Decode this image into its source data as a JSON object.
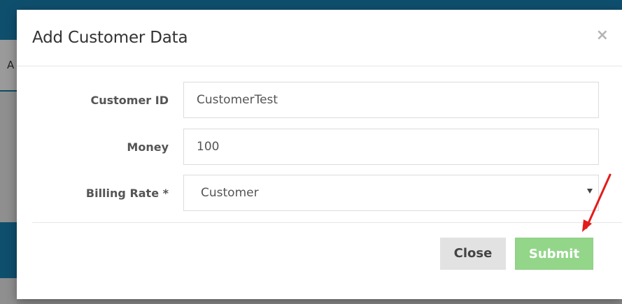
{
  "background": {
    "tab_letter": "A"
  },
  "modal": {
    "title": "Add Customer Data",
    "close_icon": "×",
    "fields": {
      "customer_id": {
        "label": "Customer ID",
        "value": "CustomerTest"
      },
      "money": {
        "label": "Money",
        "value": "100"
      },
      "billing_rate": {
        "label": "Billing Rate *",
        "selected": "Customer"
      }
    },
    "buttons": {
      "close_label": "Close",
      "submit_label": "Submit"
    }
  },
  "colors": {
    "header_blue": "#0f4f6e",
    "submit_green": "#93d68a",
    "close_gray": "#e2e2e2",
    "annotation_red": "#e41b1b"
  },
  "icons": {
    "close": "close-icon",
    "caret": "chevron-down-icon",
    "annotation": "red-arrow-annotation"
  }
}
